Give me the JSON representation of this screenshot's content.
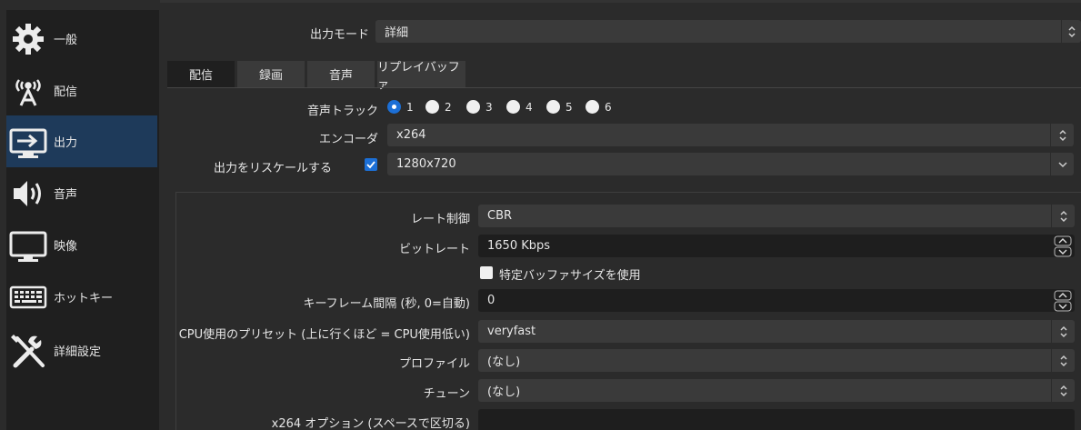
{
  "sidebar": {
    "items": [
      {
        "label": "一般",
        "icon": "gear-icon",
        "active": false
      },
      {
        "label": "配信",
        "icon": "broadcast-icon",
        "active": false
      },
      {
        "label": "出力",
        "icon": "output-icon",
        "active": true
      },
      {
        "label": "音声",
        "icon": "speaker-icon",
        "active": false
      },
      {
        "label": "映像",
        "icon": "monitor-icon",
        "active": false
      },
      {
        "label": "ホットキー",
        "icon": "keyboard-icon",
        "active": false
      },
      {
        "label": "詳細設定",
        "icon": "tools-icon",
        "active": false
      }
    ]
  },
  "output_mode": {
    "label": "出力モード",
    "value": "詳細"
  },
  "tabs": [
    {
      "label": "配信",
      "active": true
    },
    {
      "label": "録画",
      "active": false
    },
    {
      "label": "音声",
      "active": false
    },
    {
      "label": "リプレイバッファ",
      "active": false
    }
  ],
  "audio_track": {
    "label": "音声トラック",
    "options": [
      "1",
      "2",
      "3",
      "4",
      "5",
      "6"
    ],
    "selected": "1"
  },
  "encoder": {
    "label": "エンコーダ",
    "value": "x264"
  },
  "rescale": {
    "label": "出力をリスケールする",
    "checked": true,
    "value": "1280x720"
  },
  "encoder_settings": {
    "rate_control": {
      "label": "レート制御",
      "value": "CBR"
    },
    "bitrate": {
      "label": "ビットレート",
      "value": "1650 Kbps"
    },
    "custom_buffer": {
      "label": "特定バッファサイズを使用",
      "checked": false
    },
    "keyframe": {
      "label": "キーフレーム間隔 (秒, 0=自動)",
      "value": "0"
    },
    "cpu_preset": {
      "label": "CPU使用のプリセット (上に行くほど = CPU使用低い)",
      "value": "veryfast"
    },
    "profile": {
      "label": "プロファイル",
      "value": "(なし)"
    },
    "tune": {
      "label": "チューン",
      "value": "(なし)"
    },
    "x264_options": {
      "label": "x264 オプション (スペースで区切る)",
      "value": ""
    }
  },
  "colors": {
    "accent": "#1c6fd6",
    "sidebar_active": "#1e3a5a",
    "panel": "#2b2b2b",
    "field": "#3a3a3a",
    "field_dark": "#1e1e1e"
  }
}
